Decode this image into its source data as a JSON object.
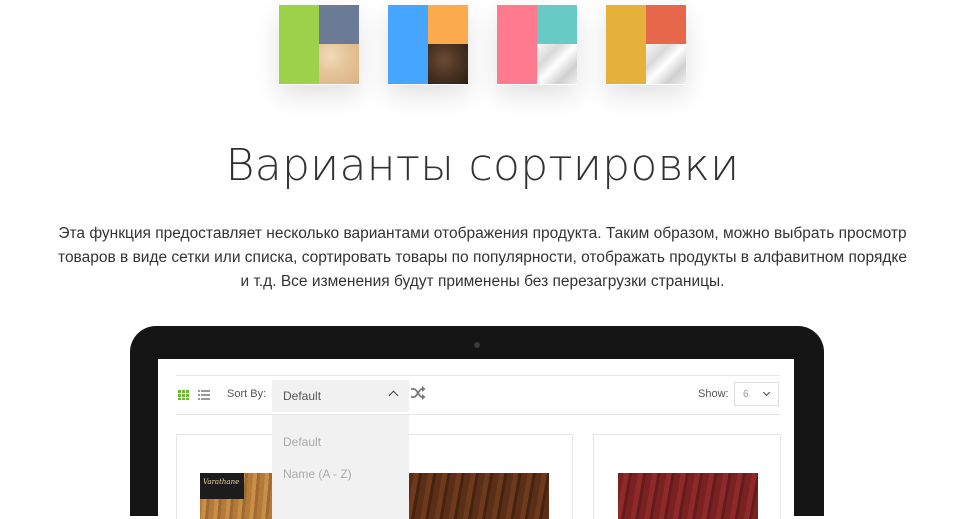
{
  "swatches": [
    {
      "name": "green-gray-sand",
      "left": "#9ed14a",
      "top_right": "#6b7a95",
      "bottom_right": "texture-sand"
    },
    {
      "name": "blue-orange-wood",
      "left": "#45a5ff",
      "top_right": "#fbab4e",
      "bottom_right": "texture-dark-wood"
    },
    {
      "name": "pink-teal-silver",
      "left": "#ff7a8e",
      "top_right": "#67cac5",
      "bottom_right": "texture-silver"
    },
    {
      "name": "mustard-coral-silver",
      "left": "#e6b13a",
      "top_right": "#e6674a",
      "bottom_right": "texture-silver"
    }
  ],
  "heading": "Варианты сортировки",
  "description": "Эта функция предоставляет несколько вариантами отображения продукта. Таким образом, можно выбрать просмотр товаров в виде сетки или списка, сортировать товары по популярности, отображать продукты в алфавитном порядке и т.д. Все изменения будут применены без перезагрузки страницы.",
  "store": {
    "view_icons": [
      "grid-view-icon",
      "list-view-icon"
    ],
    "sort_label": "Sort By:",
    "sort_value": "Default",
    "sort_options": [
      "Default",
      "Name (A - Z)"
    ],
    "shuffle_icon": "shuffle-icon",
    "show_label": "Show:",
    "show_value": "6",
    "product_brand_text": "Varathane",
    "colors": {
      "accent_green": "#6fb33a",
      "bezel": "#151515"
    }
  }
}
